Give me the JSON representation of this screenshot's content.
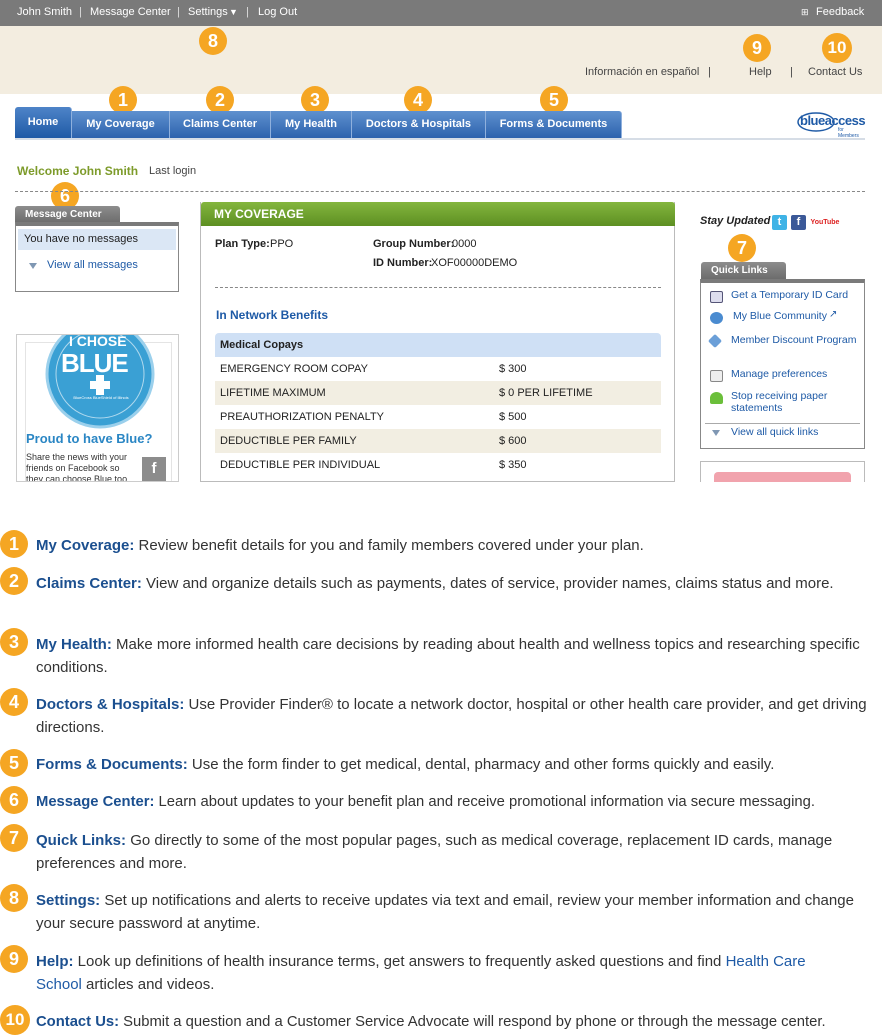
{
  "topbar": {
    "user": "John Smith",
    "message_center": "Message Center",
    "settings": "Settings",
    "logout": "Log Out",
    "feedback": "Feedback"
  },
  "header_links": {
    "spanish": "Información en español",
    "help": "Help",
    "contact": "Contact Us"
  },
  "tabs": [
    "Home",
    "My Coverage",
    "Claims Center",
    "My Health",
    "Doctors & Hospitals",
    "Forms & Documents"
  ],
  "logo": {
    "text": "blueaccess",
    "sub": "for Members"
  },
  "welcome": "Welcome John Smith",
  "last_login": "Last login",
  "message_center": {
    "title": "Message Center",
    "empty": "You have no messages",
    "view_all": "View all messages"
  },
  "promo": {
    "badge_top": "I CHOSE",
    "badge_main": "BLUE",
    "badge_sub": "BlueCross BlueShield of Illinois",
    "heading": "Proud to have Blue?",
    "body": "Share the news with your friends on Facebook so they can choose Blue too."
  },
  "coverage": {
    "title": "MY COVERAGE",
    "plan_type_label": "Plan Type:",
    "plan_type": "PPO",
    "group_label": "Group Number:",
    "group": "0000",
    "id_label": "ID Number:",
    "id": "XOF00000DEMO",
    "section": "In Network Benefits",
    "table_header": "Medical Copays",
    "rows": [
      {
        "label": "EMERGENCY ROOM COPAY",
        "value": "$ 300"
      },
      {
        "label": "LIFETIME MAXIMUM",
        "value": "$ 0 PER LIFETIME"
      },
      {
        "label": "PREAUTHORIZATION PENALTY",
        "value": "$ 500"
      },
      {
        "label": "DEDUCTIBLE PER FAMILY",
        "value": "$ 600"
      },
      {
        "label": "DEDUCTIBLE PER INDIVIDUAL",
        "value": "$ 350"
      }
    ]
  },
  "stay_updated": "Stay Updated",
  "social": {
    "twitter": "t",
    "facebook": "f",
    "youtube": "YouTube"
  },
  "quick_links": {
    "title": "Quick Links",
    "items": [
      "Get a Temporary ID Card",
      "My Blue Community",
      "Member Discount Program",
      "Manage preferences",
      "Stop receiving paper statements"
    ],
    "view_all": "View all quick links"
  },
  "callouts": [
    "1",
    "2",
    "3",
    "4",
    "5",
    "6",
    "7",
    "8",
    "9",
    "10"
  ],
  "legend": [
    {
      "num": "1",
      "term": "My Coverage:",
      "text": " Review benefit details for you and family members covered under your plan."
    },
    {
      "num": "2",
      "term": "Claims Center:",
      "text": " View and organize details such as payments, dates of service, provider names, claims status and more."
    },
    {
      "num": "3",
      "term": "My Health:",
      "text": " Make more informed health care decisions by reading about health and wellness topics and researching specific conditions."
    },
    {
      "num": "4",
      "term": "Doctors & Hospitals:",
      "text": " Use Provider Finder® to locate a network doctor, hospital or other health care provider, and get driving directions."
    },
    {
      "num": "5",
      "term": "Forms & Documents:",
      "text": " Use the form finder to get medical, dental, pharmacy and other forms quickly and easily."
    },
    {
      "num": "6",
      "term": "Message Center:",
      "text": " Learn about updates to your benefit plan and receive promotional information via secure messaging."
    },
    {
      "num": "7",
      "term": "Quick Links:",
      "text": " Go directly to some of the most popular pages, such as medical coverage, replacement ID cards, manage preferences and more."
    },
    {
      "num": "8",
      "term": "Settings:",
      "text": " Set up notifications and alerts to receive updates via text and email, review your member information and change your secure password at anytime."
    },
    {
      "num": "9",
      "term": "Help:",
      "text": " Look up definitions of health insurance terms, get answers to frequently asked questions and find ",
      "link": "Health Care School",
      "after": " articles and videos."
    },
    {
      "num": "10",
      "term": "Contact Us:",
      "text": " Submit a question and a Customer Service Advocate will respond by phone or through the message center."
    }
  ]
}
